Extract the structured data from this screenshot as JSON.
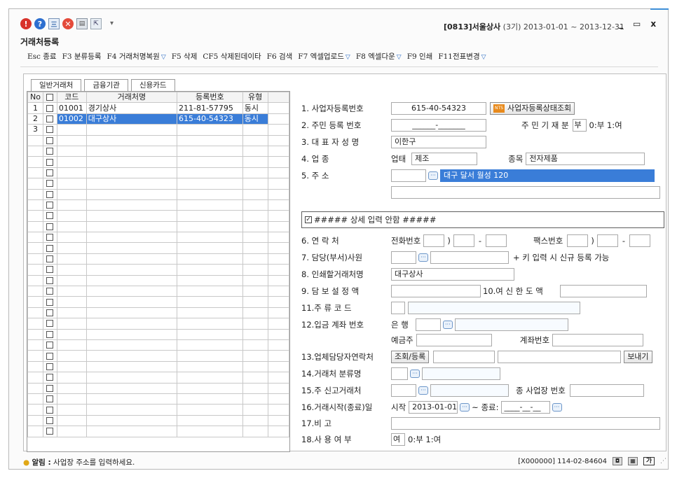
{
  "window": {
    "title": "거래처등록",
    "company": "[0813]서울상사",
    "period": "(3기) 2013-01-01 ~ 2013-12-31",
    "controls": {
      "minimize": "_",
      "maximize": "▭",
      "close": "x"
    }
  },
  "toolbar": {
    "items": [
      {
        "label": "Esc 종료",
        "dropdown": false
      },
      {
        "label": "F3 분류등록",
        "dropdown": false
      },
      {
        "label": "F4 거래처명복원",
        "dropdown": true
      },
      {
        "label": "F5 삭제",
        "dropdown": false
      },
      {
        "label": "CF5 삭제된데이타",
        "dropdown": false
      },
      {
        "label": "F6 검색",
        "dropdown": false
      },
      {
        "label": "F7 엑셀업로드",
        "dropdown": true
      },
      {
        "label": "F8 엑셀다운",
        "dropdown": true
      },
      {
        "label": "F9 인쇄",
        "dropdown": false
      },
      {
        "label": "F11전표변경",
        "dropdown": true
      }
    ]
  },
  "tabs": [
    "일반거래처",
    "금융기관",
    "신용카드"
  ],
  "grid": {
    "columns": [
      "No",
      "",
      "코드",
      "거래처명",
      "등록번호",
      "유형"
    ],
    "rows": [
      {
        "no": "1",
        "code": "01001",
        "name": "경기상사",
        "reg": "211-81-57795",
        "type": "동시"
      },
      {
        "no": "2",
        "code": "01002",
        "name": "대구상사",
        "reg": "615-40-54323",
        "type": "동시"
      },
      {
        "no": "3",
        "code": "",
        "name": "",
        "reg": "",
        "type": ""
      }
    ]
  },
  "form": {
    "biz_no_label": "1. 사업자등록번호",
    "biz_no": "615-40-54323",
    "biz_status_button": "사업자등록상태조회",
    "nts_badge": "NTS",
    "resident_label": "2. 주민 등록 번호",
    "resident_value": "______-_______",
    "resident_type_label": "주 민 기 재 분",
    "resident_type_value": "부",
    "resident_type_hint": "0:부 1:여",
    "ceo_label": "3. 대 표 자 성 명",
    "ceo_value": "이한구",
    "biz_type_label": "4. 업          종",
    "biz_type_sub": "업태",
    "biz_type_value": "제조",
    "item_sub": "종목",
    "item_value": "전자제품",
    "address_label": "5. 주          소",
    "address_value": "대구 달서 월성 120",
    "detail_text_pre": "##### 상세 입력 안함 #####",
    "contact_label": "6. 연    락    처",
    "phone_sub": "전화번호",
    "fax_sub": "팩스번호",
    "manager_label": "7. 담당(부서)사원",
    "manager_hint": "+ 키 입력 시 신규 등록 가능",
    "print_name_label": "8. 인쇄할거래처명",
    "print_name_value": "대구상사",
    "collateral_label": "9. 담 보 설 정 액",
    "credit_label": "10.여 신 한 도 액",
    "liquor_label": "11.주    류    코    드",
    "account_label": "12.입금 계좌 번호",
    "bank_sub": "은  행",
    "depositor_sub": "예금주",
    "account_no_sub": "계좌번호",
    "contact_person_label": "13.업체담당자연락처",
    "lookup_button": "조회/등록",
    "send_button": "보내기",
    "category_label": "14.거래처 분류명",
    "main_report_label": "15.주 신고거래처",
    "sub_biz_label": "종 사업장 번호",
    "period_label": "16.거래시작(종료)일",
    "start_sub": "시작",
    "start_value": "2013-01-01",
    "end_sub": "~ 종료:",
    "end_value": "____-__-__",
    "note_label": "17.비          고",
    "use_label": "18.사 용 여 부",
    "use_value": "여",
    "use_hint": "0:부 1:여"
  },
  "status": {
    "alert_label": "알림 :",
    "alert_text": "사업장 주소를 입력하세요.",
    "right_code": "[X000000] 114-02-84604",
    "ime": "가"
  }
}
